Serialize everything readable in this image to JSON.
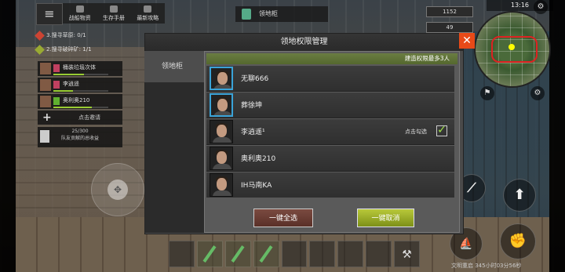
{
  "hud": {
    "menu_icon": "menu-icon",
    "top_tabs": [
      "战船物资",
      "生存手册",
      "最新攻略"
    ],
    "tasks": [
      "3.搜寻草原: 0/1",
      "2.搜寻破碎矿: 1/1"
    ],
    "members": [
      {
        "name": "桶装垃圾次体",
        "badge_color": "#c04060",
        "hp": 0.55
      },
      {
        "name": "李逍遥",
        "badge_color": "#c04060",
        "hp": 0.35
      },
      {
        "name": "奥利奥210",
        "badge_color": "#60b030",
        "hp": 0.7
      }
    ],
    "invite_label": "点击邀请",
    "earn_count": "25/300",
    "earn_label": "队友贡献的总收益",
    "storage_label": "领地柜",
    "clock": "13:16",
    "status_values": [
      "1152",
      "49"
    ],
    "notice": "文明重启 345小时03分56秒",
    "hotbar_tool_icon": "hammer-wrench-icon"
  },
  "dialog": {
    "title": "领地权限管理",
    "side_tab": "领地柜",
    "limit_text": "建造权限最多3人",
    "players": [
      {
        "name": "无聊666",
        "selected_avatar": true,
        "show_check": false
      },
      {
        "name": "葬徐坤",
        "selected_avatar": true,
        "show_check": false
      },
      {
        "name": "李逍遥¹",
        "selected_avatar": false,
        "show_check": true
      },
      {
        "name": "奥利奥210",
        "selected_avatar": false,
        "show_check": false
      },
      {
        "name": "IH马南KA",
        "selected_avatar": false,
        "show_check": false
      }
    ],
    "check_label": "点击勾选",
    "check_mark": "✓",
    "select_all": "一键全选",
    "cancel_all": "一键取消",
    "close_symbol": "✕"
  }
}
